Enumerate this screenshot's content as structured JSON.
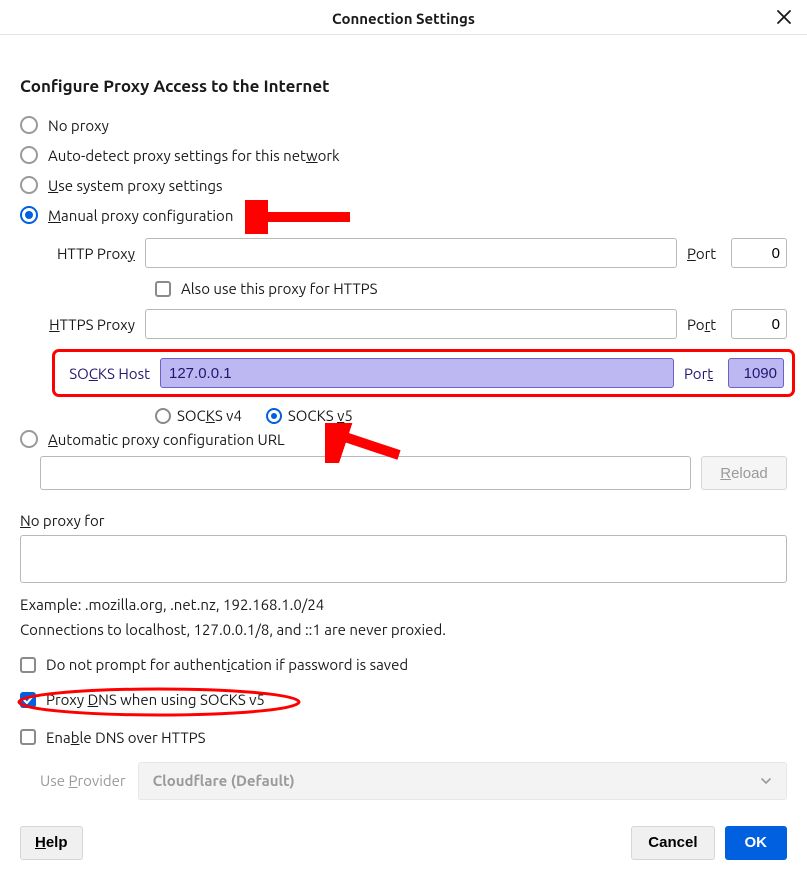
{
  "window": {
    "title": "Connection Settings"
  },
  "heading": "Configure Proxy Access to the Internet",
  "radios": {
    "no_proxy": "No proxy",
    "auto_detect_pre": "Auto-detect proxy settings for this net",
    "auto_detect_m": "w",
    "auto_detect_post": "ork",
    "system_m": "U",
    "system_post": "se system proxy settings",
    "manual_m": "M",
    "manual_post": "anual proxy configuration"
  },
  "proxy": {
    "http_label_pre": "HTTP Prox",
    "http_label_m": "y",
    "http_value": "",
    "http_port_label_m": "P",
    "http_port_label_post": "ort",
    "http_port": "0",
    "also_https": "Also use this proxy for HTTPS",
    "https_label_m": "H",
    "https_label_post": "TTPS Proxy",
    "https_value": "",
    "https_port_label_pre": "Po",
    "https_port_label_m": "r",
    "https_port_label_post": "t",
    "https_port": "0",
    "socks_label_pre": "SO",
    "socks_label_m": "C",
    "socks_label_post": "KS Host",
    "socks_value": "127.0.0.1",
    "socks_port_label_pre": "Por",
    "socks_port_label_m": "t",
    "socks_port": "1090",
    "socks_v4_pre": "SOC",
    "socks_v4_m": "K",
    "socks_v4_post": "S v4",
    "socks_v5_pre": "SOCKS ",
    "socks_v5_m": "v",
    "socks_v5_post": "5"
  },
  "autoConfig": {
    "label_m": "A",
    "label_post": "utomatic proxy configuration URL",
    "url": "",
    "reload_m": "R",
    "reload_pre": "",
    "reload_post": "eload"
  },
  "noProxy": {
    "label_m": "N",
    "label_post": "o proxy for",
    "value": "",
    "example": "Example: .mozilla.org, .net.nz, 192.168.1.0/24",
    "note": "Connections to localhost, 127.0.0.1/8, and ::1 are never proxied."
  },
  "checks": {
    "no_prompt_pre": "Do not prompt for authent",
    "no_prompt_m": "i",
    "no_prompt_post": "cation if password is saved",
    "proxy_dns_pre": "Proxy ",
    "proxy_dns_m": "D",
    "proxy_dns_post": "NS when using SOCKS v5",
    "enable_doh_pre": "Ena",
    "enable_doh_m": "b",
    "enable_doh_post": "le DNS over HTTPS"
  },
  "provider": {
    "label_pre": "Use ",
    "label_m": "P",
    "label_post": "rovider",
    "value": "Cloudflare (Default)"
  },
  "buttons": {
    "help_m": "H",
    "help_post": "elp",
    "cancel": "Cancel",
    "ok": "OK"
  }
}
